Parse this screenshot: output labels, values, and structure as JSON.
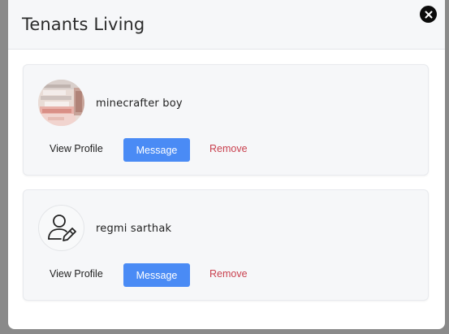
{
  "modal": {
    "title": "Tenants Living",
    "close_icon": "close-icon"
  },
  "tenants": [
    {
      "name": "minecrafter boy",
      "avatar": "profile-photo",
      "actions": {
        "view": "View Profile",
        "message": "Message",
        "remove": "Remove"
      }
    },
    {
      "name": "regmi sarthak",
      "avatar": "user-edit-icon",
      "actions": {
        "view": "View Profile",
        "message": "Message",
        "remove": "Remove"
      }
    }
  ],
  "colors": {
    "message_button": "#4a8bf5",
    "remove_text": "#c9414f",
    "card_background": "#f6f7f9",
    "backdrop": "#8a8a8a"
  }
}
